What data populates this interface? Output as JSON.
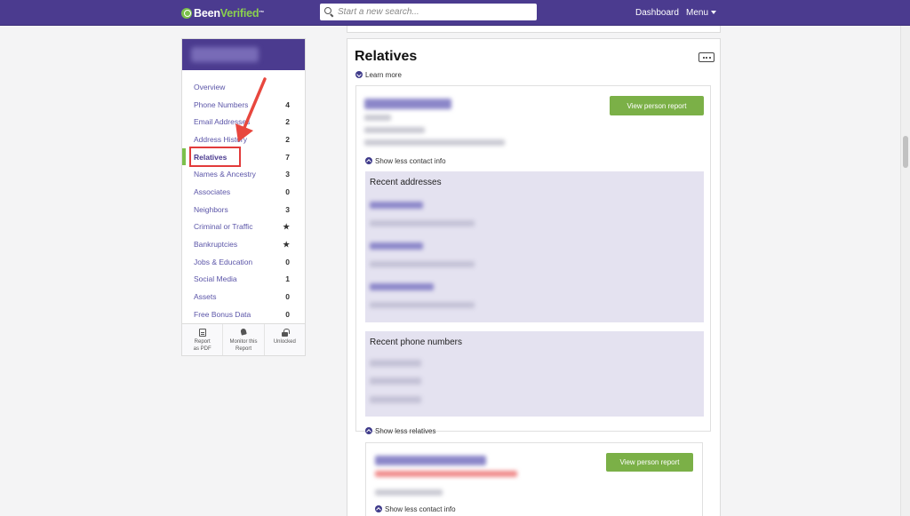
{
  "topbar": {
    "logo_been": "Been",
    "logo_verified": "Verified",
    "search_placeholder": "Start a new search...",
    "dashboard": "Dashboard",
    "menu": "Menu"
  },
  "sidebar": {
    "items": [
      {
        "label": "Overview",
        "count": ""
      },
      {
        "label": "Phone Numbers",
        "count": "4"
      },
      {
        "label": "Email Addresses",
        "count": "2"
      },
      {
        "label": "Address History",
        "count": "2"
      },
      {
        "label": "Relatives",
        "count": "7"
      },
      {
        "label": "Names & Ancestry",
        "count": "3"
      },
      {
        "label": "Associates",
        "count": "0"
      },
      {
        "label": "Neighbors",
        "count": "3"
      },
      {
        "label": "Criminal or Traffic",
        "count": "★"
      },
      {
        "label": "Bankruptcies",
        "count": "★"
      },
      {
        "label": "Jobs & Education",
        "count": "0"
      },
      {
        "label": "Social Media",
        "count": "1"
      },
      {
        "label": "Assets",
        "count": "0"
      },
      {
        "label": "Free Bonus Data",
        "count": "0"
      }
    ],
    "footer": {
      "pdf_line1": "Report",
      "pdf_line2": "as PDF",
      "monitor_line1": "Monitor this",
      "monitor_line2": "Report",
      "unlocked": "Unlocked"
    }
  },
  "main": {
    "title": "Relatives",
    "learn_more": "Learn more",
    "view_report": "View person report",
    "show_less_contact": "Show less contact info",
    "recent_addresses": "Recent addresses",
    "recent_phones": "Recent phone numbers",
    "show_less_relatives": "Show less relatives"
  },
  "colors": {
    "brand_purple": "#4b3b8f",
    "accent_green": "#7cc04b",
    "highlight_red": "#e23b3b"
  }
}
